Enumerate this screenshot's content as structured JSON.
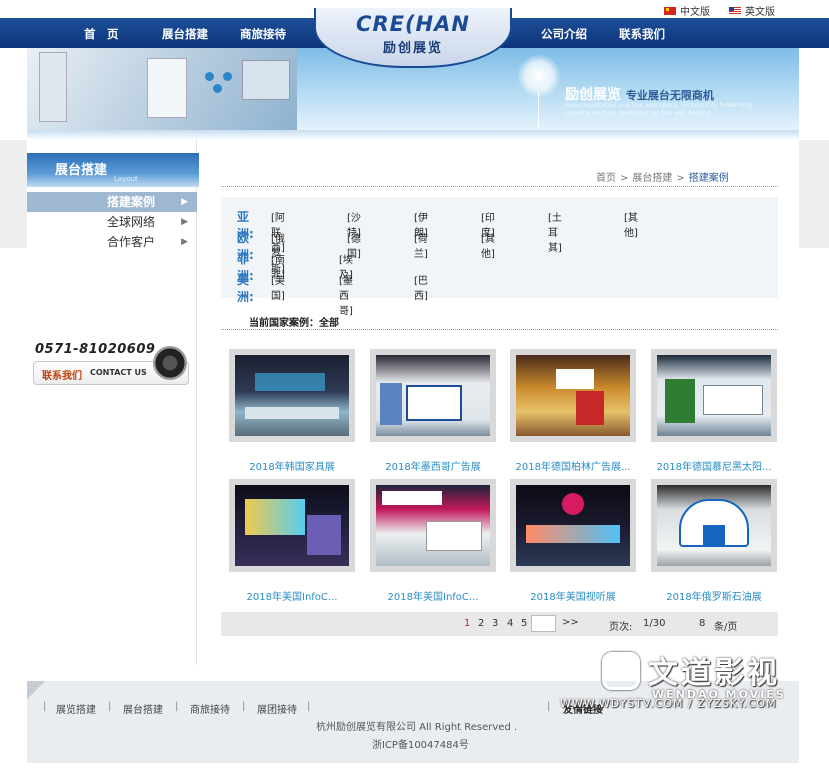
{
  "language": {
    "cn": "中文版",
    "en": "英文版"
  },
  "nav": {
    "left": [
      "首　页",
      "展台搭建",
      "商旅接待"
    ],
    "right": [
      "公司介绍",
      "联系我们"
    ]
  },
  "logo": {
    "text": "CRE(HAN",
    "sub": "励创展览"
  },
  "banner": {
    "title": "励创展览",
    "title2": "专业展台无限商机",
    "sub": "none registration and free web space. Fortune City forwarding Lonestar hosting, dedicated ad-free web hosting."
  },
  "sidebar": {
    "title": "展台搭建",
    "subtitle": "Layout",
    "items": [
      {
        "label": "搭建案例",
        "active": true
      },
      {
        "label": "全球网络",
        "active": false
      },
      {
        "label": "合作客户",
        "active": false
      }
    ],
    "phone": "0571-81020609",
    "contact_cn": "联系我们",
    "contact_en": "CONTACT US"
  },
  "breadcrumb": {
    "home": "首页",
    "section": "展台搭建",
    "current": "搭建案例",
    "separator": ">"
  },
  "regions": [
    {
      "label": "亚洲:",
      "countries": [
        "[阿联酋]",
        "[沙特]",
        "[伊朗]",
        "[印度]",
        "[土耳其]",
        "[其他]"
      ]
    },
    {
      "label": "欧洲:",
      "countries": [
        "[俄罗斯]",
        "[德国]",
        "[荷兰]",
        "[其他]"
      ]
    },
    {
      "label": "非洲:",
      "countries": [
        "[南非]",
        "[埃及]"
      ]
    },
    {
      "label": "美洲:",
      "countries": [
        "[美国]",
        "[墨西哥]",
        "[巴西]"
      ]
    }
  ],
  "current_cases": "当前国家案例：全部",
  "cases": [
    {
      "caption": "2018年韩国家具展"
    },
    {
      "caption": "2018年墨西哥广告展"
    },
    {
      "caption": "2018年德国柏林广告展..."
    },
    {
      "caption": "2018年德国慕尼黑太阳..."
    },
    {
      "caption": "2018年美国InfoC..."
    },
    {
      "caption": "2018年美国InfoC..."
    },
    {
      "caption": "2018年美国视听展"
    },
    {
      "caption": "2018年俄罗斯石油展"
    }
  ],
  "pager": {
    "pages": [
      "1",
      "2",
      "3",
      "4",
      "5"
    ],
    "current": "1",
    "go": ">>",
    "pages_label": "页次:",
    "pages_value": "1/30",
    "per_page_value": "8",
    "per_page_label": "条/页"
  },
  "footer": {
    "links": [
      "展览搭建",
      "展台搭建",
      "商旅接待",
      "展团接待"
    ],
    "friend": "友情链接",
    "copyright": "杭州励创展览有限公司 All Right Reserved .",
    "icp": "浙ICP备10047484号"
  },
  "watermark": {
    "cn": "文道影视",
    "en": "WENDAO MOVIES",
    "url": "WWW.WDYSTV.COM / ZYZSKY.COM"
  }
}
